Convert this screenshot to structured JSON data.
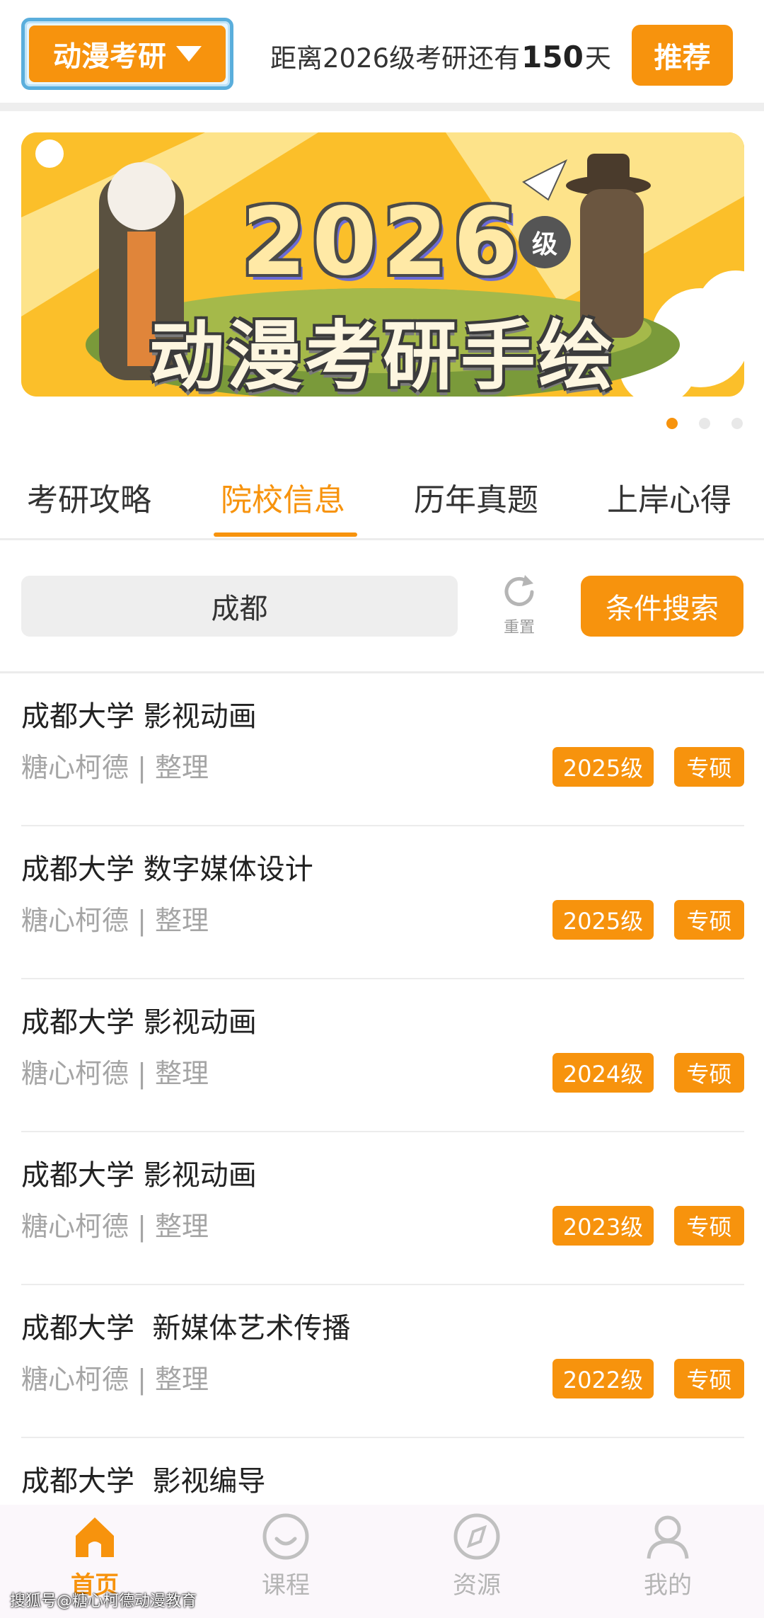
{
  "header": {
    "app_switch_label": "动漫考研",
    "countdown_prefix": "距离2026级考研还有",
    "countdown_days": "150",
    "countdown_suffix": "天",
    "recommend_label": "推荐"
  },
  "banner": {
    "year_text": "2026",
    "grade_text": "级",
    "title_text": "动漫考研手绘",
    "page_count": 3,
    "active_page": 1
  },
  "tabs": [
    {
      "label": "考研攻略",
      "active": false
    },
    {
      "label": "院校信息",
      "active": true
    },
    {
      "label": "历年真题",
      "active": false
    },
    {
      "label": "上岸心得",
      "active": false
    }
  ],
  "filter": {
    "city": "成都",
    "reset_label": "重置",
    "search_label": "条件搜索"
  },
  "list": [
    {
      "title": "成都大学 影视动画",
      "sub": "糖心柯德 | 整理",
      "grade": "2025级",
      "type": "专硕"
    },
    {
      "title": "成都大学 数字媒体设计",
      "sub": "糖心柯德 | 整理",
      "grade": "2025级",
      "type": "专硕"
    },
    {
      "title": "成都大学 影视动画",
      "sub": "糖心柯德 | 整理",
      "grade": "2024级",
      "type": "专硕"
    },
    {
      "title": "成都大学 影视动画",
      "sub": "糖心柯德 | 整理",
      "grade": "2023级",
      "type": "专硕"
    },
    {
      "title": "成都大学  新媒体艺术传播",
      "sub": "糖心柯德 | 整理",
      "grade": "2022级",
      "type": "专硕"
    },
    {
      "title": "成都大学  影视编导",
      "sub": "",
      "grade": "",
      "type": ""
    }
  ],
  "nav": [
    {
      "label": "首页",
      "icon": "home-icon",
      "active": true
    },
    {
      "label": "课程",
      "icon": "smile-icon",
      "active": false
    },
    {
      "label": "资源",
      "icon": "compass-icon",
      "active": false
    },
    {
      "label": "我的",
      "icon": "user-icon",
      "active": false
    }
  ],
  "watermark": "搜狐号@糖心柯德动漫教育",
  "colors": {
    "accent": "#f7930d",
    "banner_bg": "#fbbf2a",
    "muted_text": "#a5a5a5",
    "divider": "#ececec"
  }
}
